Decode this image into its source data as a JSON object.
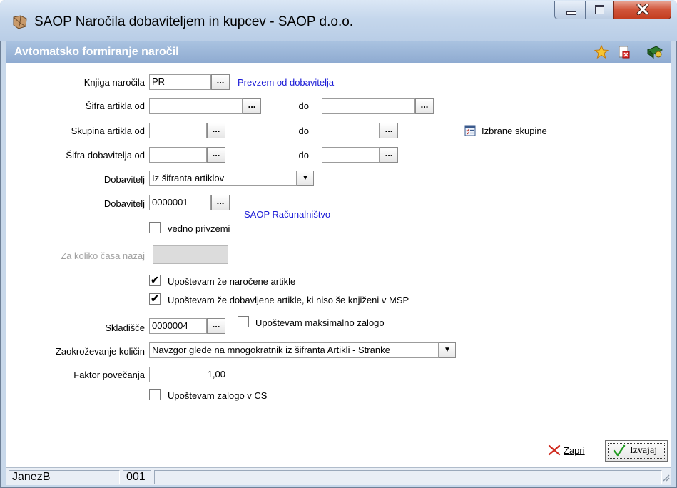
{
  "window": {
    "title": "SAOP Naročila dobaviteljem in kupcev - SAOP d.o.o.",
    "controls": [
      "minimize-icon",
      "maximize-icon",
      "close-icon"
    ]
  },
  "header": {
    "title": "Avtomatsko formiranje naročil",
    "icons": [
      "star-icon",
      "pdf-delete-icon",
      "book-run-icon"
    ]
  },
  "form": {
    "knjiga_label": "Knjiga naročila",
    "knjiga_value": "PR",
    "knjiga_desc": "Prevzem od dobavitelja",
    "sifra_artikla_label": "Šifra artikla od",
    "sifra_artikla_from": "",
    "sifra_artikla_to": "",
    "do_label": "do",
    "skupina_label": "Skupina artikla od",
    "skupina_from": "",
    "skupina_to": "",
    "izbrane_skupine": "Izbrane skupine",
    "sifra_dob_label": "Šifra dobavitelja od",
    "sifra_dob_from": "",
    "sifra_dob_to": "",
    "dobavitelj_mode_label": "Dobavitelj",
    "dobavitelj_mode_value": "Iz šifranta artiklov",
    "dobavitelj_label": "Dobavitelj",
    "dobavitelj_value": "0000001",
    "dobavitelj_name": "SAOP Računalništvo",
    "vedno_privzemi": "vedno privzemi",
    "vedno_privzemi_checked": false,
    "za_koliko_label": "Za koliko časa nazaj",
    "za_koliko_value": "",
    "upostevam_narocene": "Upoštevam že naročene artikle",
    "upostevam_narocene_checked": true,
    "upostevam_dobavljene": "Upoštevam že dobavljene artikle, ki niso še knjiženi v MSP",
    "upostevam_dobavljene_checked": true,
    "skladisce_label": "Skladišče",
    "skladisce_value": "0000004",
    "upostevam_max": "Upoštevam maksimalno zalogo",
    "upostevam_max_checked": false,
    "zaokrozevanje_label": "Zaokroževanje količin",
    "zaokrozevanje_value": "Navzgor glede na mnogokratnik iz šifranta Artikli - Stranke",
    "faktor_label": "Faktor povečanja",
    "faktor_value": "1,00",
    "upostevam_zalogo_cs": "Upoštevam zalogo v CS",
    "upostevam_zalogo_cs_checked": false,
    "dots": "..."
  },
  "buttons": {
    "zapri": "Zapri",
    "izvajaj": "Izvajaj"
  },
  "status": {
    "user": "JanezB",
    "code": "001"
  }
}
